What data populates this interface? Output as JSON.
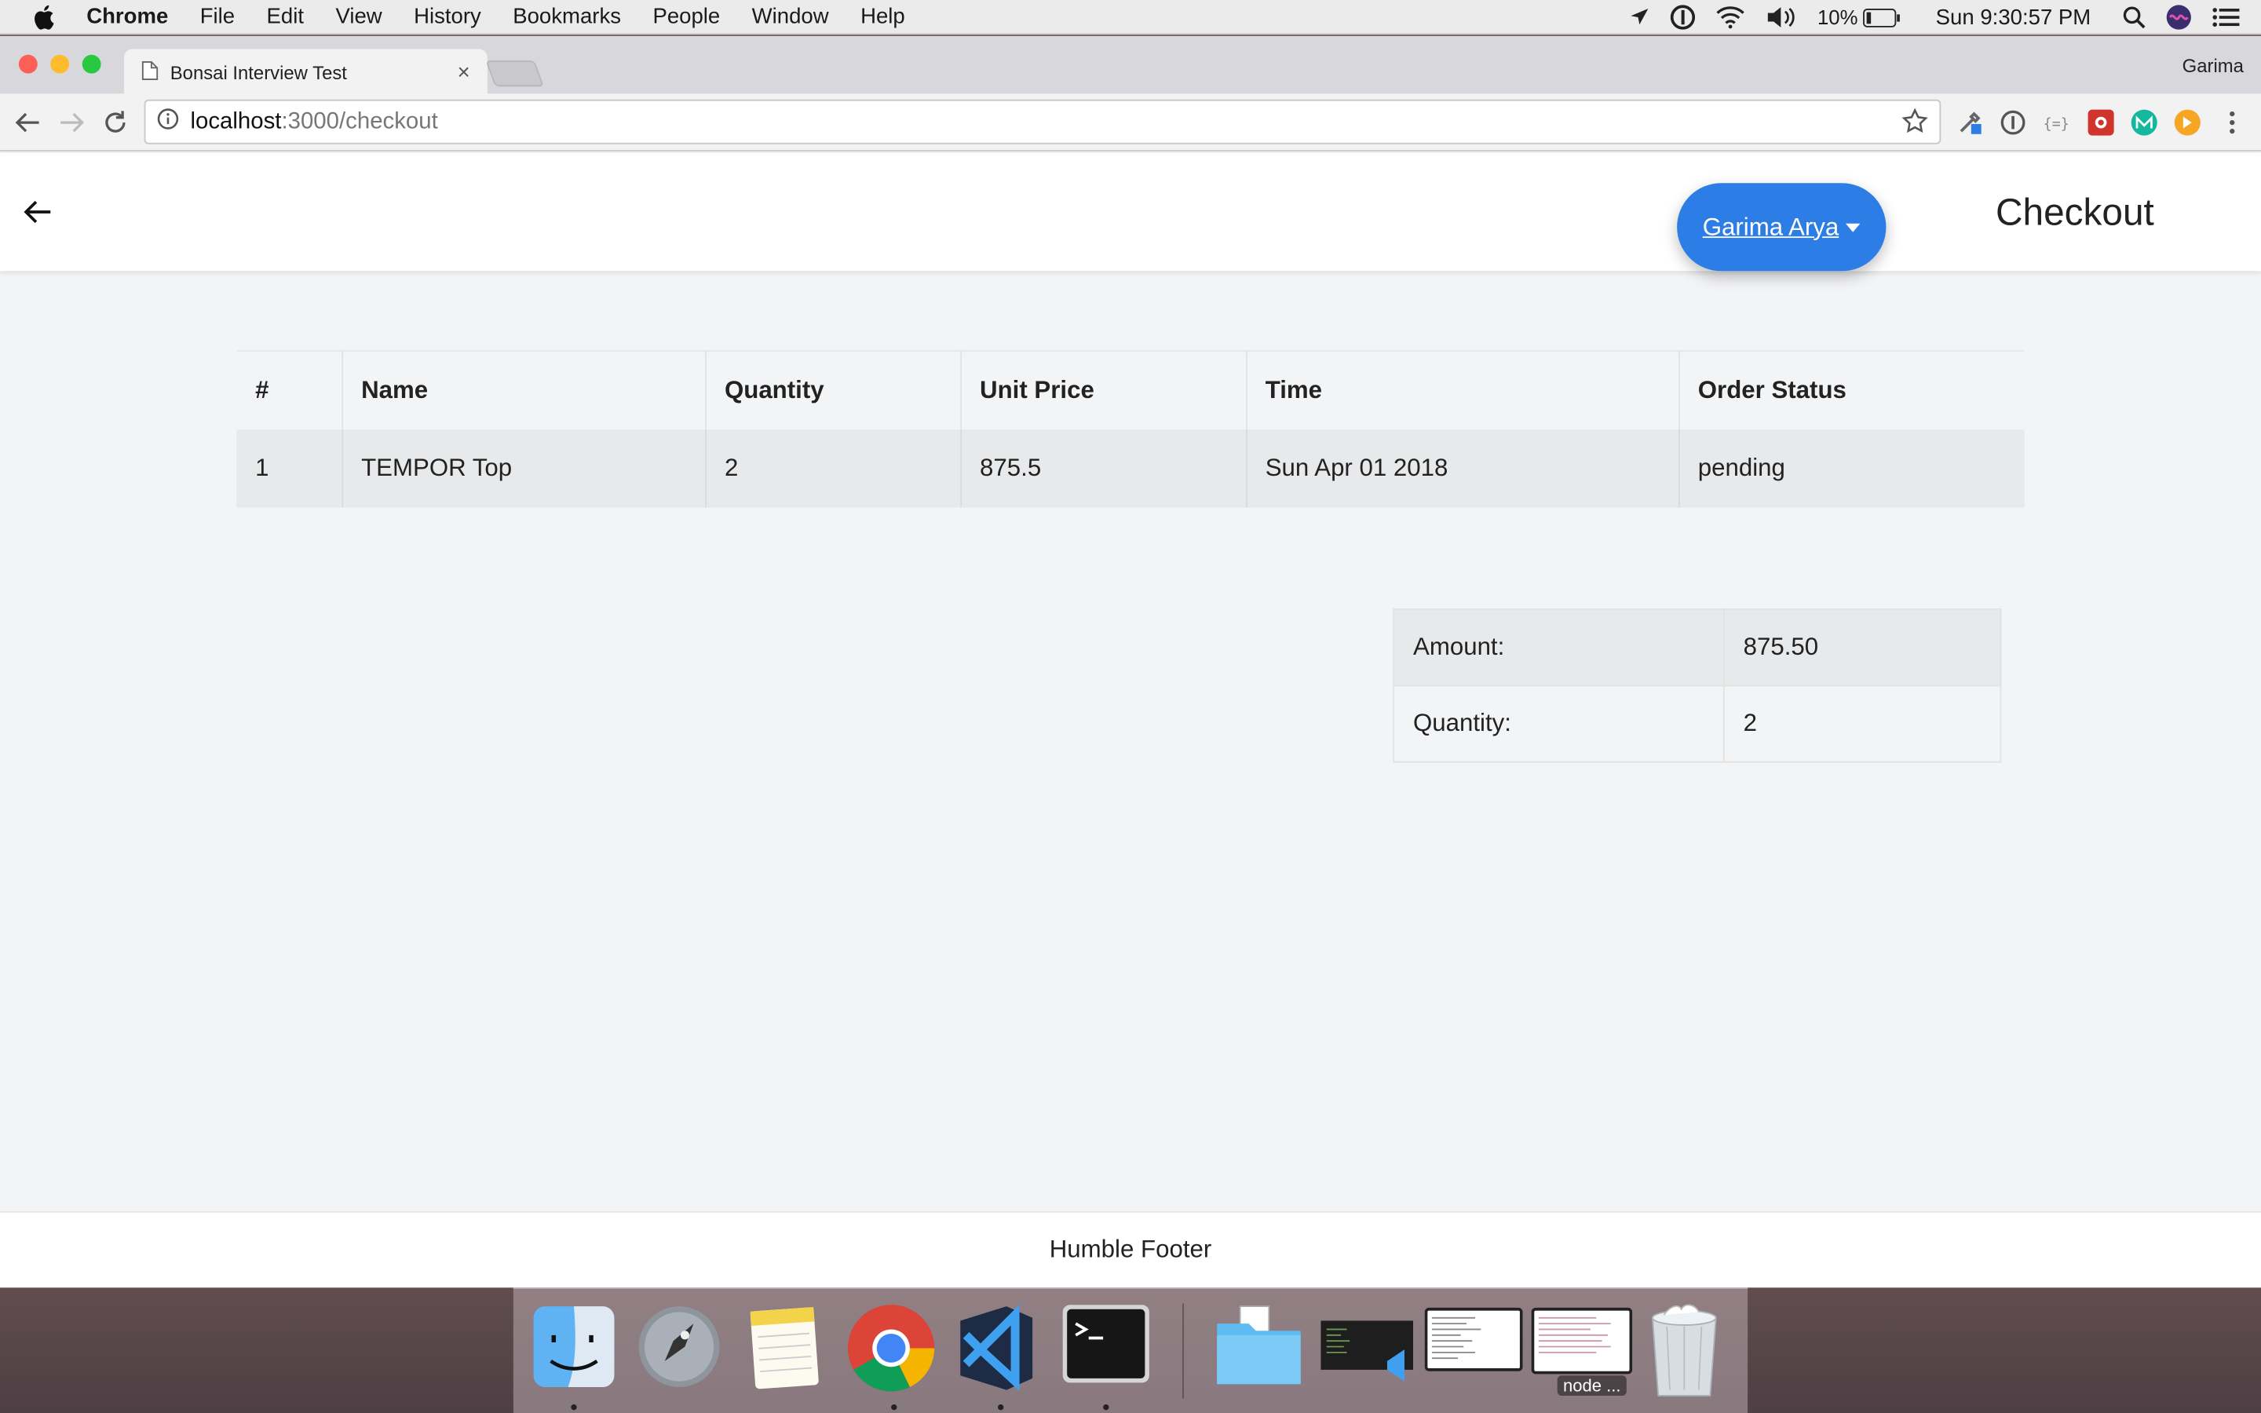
{
  "menubar": {
    "app": "Chrome",
    "items": [
      "File",
      "Edit",
      "View",
      "History",
      "Bookmarks",
      "People",
      "Window",
      "Help"
    ],
    "battery": "10%",
    "clock": "Sun 9:30:57 PM"
  },
  "browser": {
    "tab_title": "Bonsai Interview Test",
    "tab_close": "×",
    "profile": "Garima",
    "url_host": "localhost",
    "url_path": ":3000/checkout"
  },
  "header": {
    "user_name": "Garima Arya",
    "title": "Checkout"
  },
  "orders": {
    "columns": [
      "#",
      "Name",
      "Quantity",
      "Unit Price",
      "Time",
      "Order Status"
    ],
    "rows": [
      [
        "1",
        "TEMPOR Top",
        "2",
        "875.5",
        "Sun Apr 01 2018",
        "pending"
      ]
    ]
  },
  "summary": {
    "rows": [
      {
        "label": "Amount:",
        "value": "875.50"
      },
      {
        "label": "Quantity:",
        "value": "2"
      }
    ]
  },
  "footer": {
    "text": "Humble Footer"
  },
  "dock": {
    "label": "node ..."
  },
  "colors": {
    "primary": "#2d7de6",
    "page_bg": "#f3f4f6",
    "row_bg": "#e8e9ea"
  }
}
